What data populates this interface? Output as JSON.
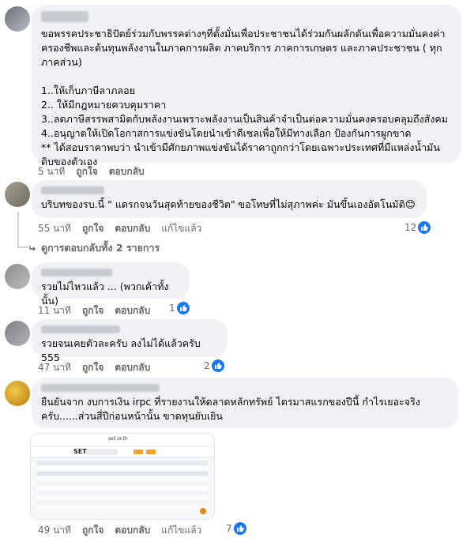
{
  "comments": [
    {
      "text": "ขอพรรคประชาธิปัตย์ร่วมกับพรรคต่างๆที่ตั้งมั่นเพื่อประชาชนได้ร่วมกันผลักดันเพื่อความมั่นคงค่าครองชีพและต้นทุนพลังงานในภาคการผลิต ภาคบริการ ภาคการเกษตร และภาคประชาชน ( ทุกภาคส่วน)\n\n1..ให้เก็บภาษีลาภลอย\n2.. ให้มีกฎหมายควบคุมราคา\n3..ลดภาษีสรรพสามิตกับพลังงานเพราะพลังงานเป็นสินค้าจำเป็นต่อความมั่นคงครอบคลุมถึงสังคม\n4..อนุญาตให้เปิดโอกาสการแข่งขันโดยนำเข้าดีเซลเพื่อให้มีทางเลือก ป้องกันการผูกขาด\n** ได้สอบราคาพบว่า นำเข้ามีศักยภาพแข่งขันได้ราคาถูกกว่าโดยเฉพาะประเทศที่มีแหล่งน้ำมันดิบของตัวเอง",
      "time": "5 นาที",
      "like": "ถูกใจ",
      "reply": "ตอบกลับ"
    },
    {
      "text": "บริบทของรบ.นี้ \" แดรกจนวันสุดท้ายของชีวิต\" ขอโทษที่ไม่สุภาพค่ะ มันขึ้นเองอัตโนมัติ😊",
      "time": "55 นาที",
      "like": "ถูกใจ",
      "reply": "ตอบกลับ",
      "edited": "แก้ไขแล้ว",
      "reactions": "12",
      "view_replies": "ดูการตอบกลับทั้ง 2 รายการ"
    },
    {
      "text": "รวยไม่ไหวแล้ว ... (พวกเค้าทั้งนั้น)",
      "time": "11 นาที",
      "like": "ถูกใจ",
      "reply": "ตอบกลับ",
      "reactions": "1"
    },
    {
      "text": "รวยจนเคยตัวละครับ ลงไม่ได้แล้วครับ 555",
      "time": "47 นาที",
      "like": "ถูกใจ",
      "reply": "ตอบกลับ",
      "reactions": "2"
    },
    {
      "text": "ยืนยันจาก งบการเงิน irpc ที่รายงานให้ตลาดหลักทรัพย์ ไตรมาสแรกของปีนี้ กำไรเยอะจริงครับ......ส่วนสี่ปีก่อนหน้านั้น ขาดทุนยับเยิน",
      "time": "49 นาที",
      "like": "ถูกใจ",
      "reply": "ตอบกลับ",
      "edited": "แก้ไขแล้ว",
      "reactions": "7",
      "attachment": {
        "logo": "SET",
        "site": "set.or.th"
      }
    }
  ],
  "colors": {
    "like_blue": "#1877f2",
    "bubble": "#f0f2f5",
    "meta": "#65676b"
  },
  "icons": {
    "like": "thumbs-up-icon",
    "reply_arrow": "reply-arrow-icon"
  }
}
